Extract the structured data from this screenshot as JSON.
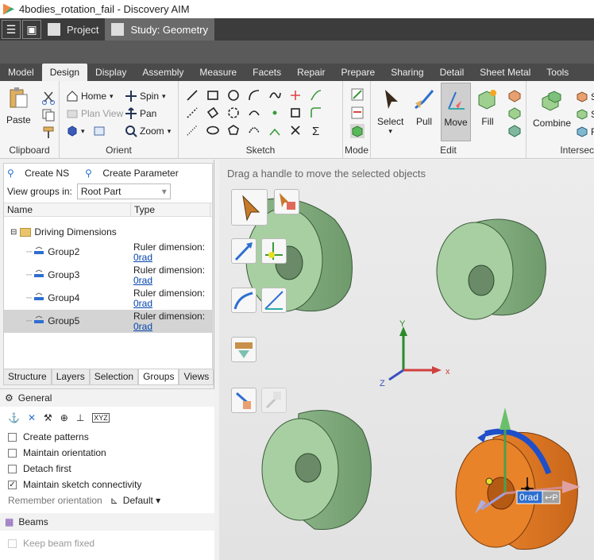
{
  "window": {
    "title": "4bodies_rotation_fail - Discovery AIM"
  },
  "studybar": {
    "project_label": "Project",
    "study_label": "Study: Geometry"
  },
  "ribbon_tabs": [
    "Model",
    "Design",
    "Display",
    "Assembly",
    "Measure",
    "Facets",
    "Repair",
    "Prepare",
    "Sharing",
    "Detail",
    "Sheet Metal",
    "Tools"
  ],
  "ribbon": {
    "clipboard": {
      "label": "Clipboard",
      "paste": "Paste"
    },
    "orient": {
      "label": "Orient",
      "home": "Home",
      "plan_view": "Plan View",
      "spin": "Spin",
      "pan": "Pan",
      "zoom": "Zoom"
    },
    "sketch": {
      "label": "Sketch"
    },
    "mode": {
      "label": "Mode"
    },
    "edit": {
      "label": "Edit",
      "select": "Select",
      "pull": "Pull",
      "move": "Move",
      "fill": "Fill"
    },
    "intersect": {
      "label": "Intersec",
      "combine": "Combine",
      "s1": "S",
      "s2": "S",
      "s3": "F"
    }
  },
  "leftpanel": {
    "create_ns": "Create NS",
    "create_parameter": "Create Parameter",
    "view_groups_label": "View groups in:",
    "view_groups_value": "Root Part",
    "col_name": "Name",
    "col_type": "Type",
    "root": "Driving Dimensions",
    "groups": [
      {
        "name": "Group2",
        "type": "Ruler dimension:",
        "value": "0rad"
      },
      {
        "name": "Group3",
        "type": "Ruler dimension:",
        "value": "0rad"
      },
      {
        "name": "Group4",
        "type": "Ruler dimension:",
        "value": "0rad"
      },
      {
        "name": "Group5",
        "type": "Ruler dimension:",
        "value": "0rad"
      }
    ],
    "tabs": [
      "Structure",
      "Layers",
      "Selection",
      "Groups",
      "Views"
    ],
    "general": "General",
    "options": {
      "create_patterns": "Create patterns",
      "maintain_orientation": "Maintain orientation",
      "detach_first": "Detach first",
      "maintain_sketch": "Maintain sketch connectivity",
      "remember_orientation": "Remember orientation",
      "default": "Default"
    },
    "beams": "Beams",
    "keep_beam_fixed": "Keep beam fixed"
  },
  "viewport": {
    "hint": "Drag a handle to move the selected objects",
    "axis_x": "x",
    "axis_y": "Y",
    "axis_z": "Z",
    "readout": "0rad",
    "readout_tag": "P"
  },
  "colors": {
    "body_green": "#a8cfa2",
    "selected_orange": "#e8832a",
    "accent_blue": "#1f4fc9"
  }
}
